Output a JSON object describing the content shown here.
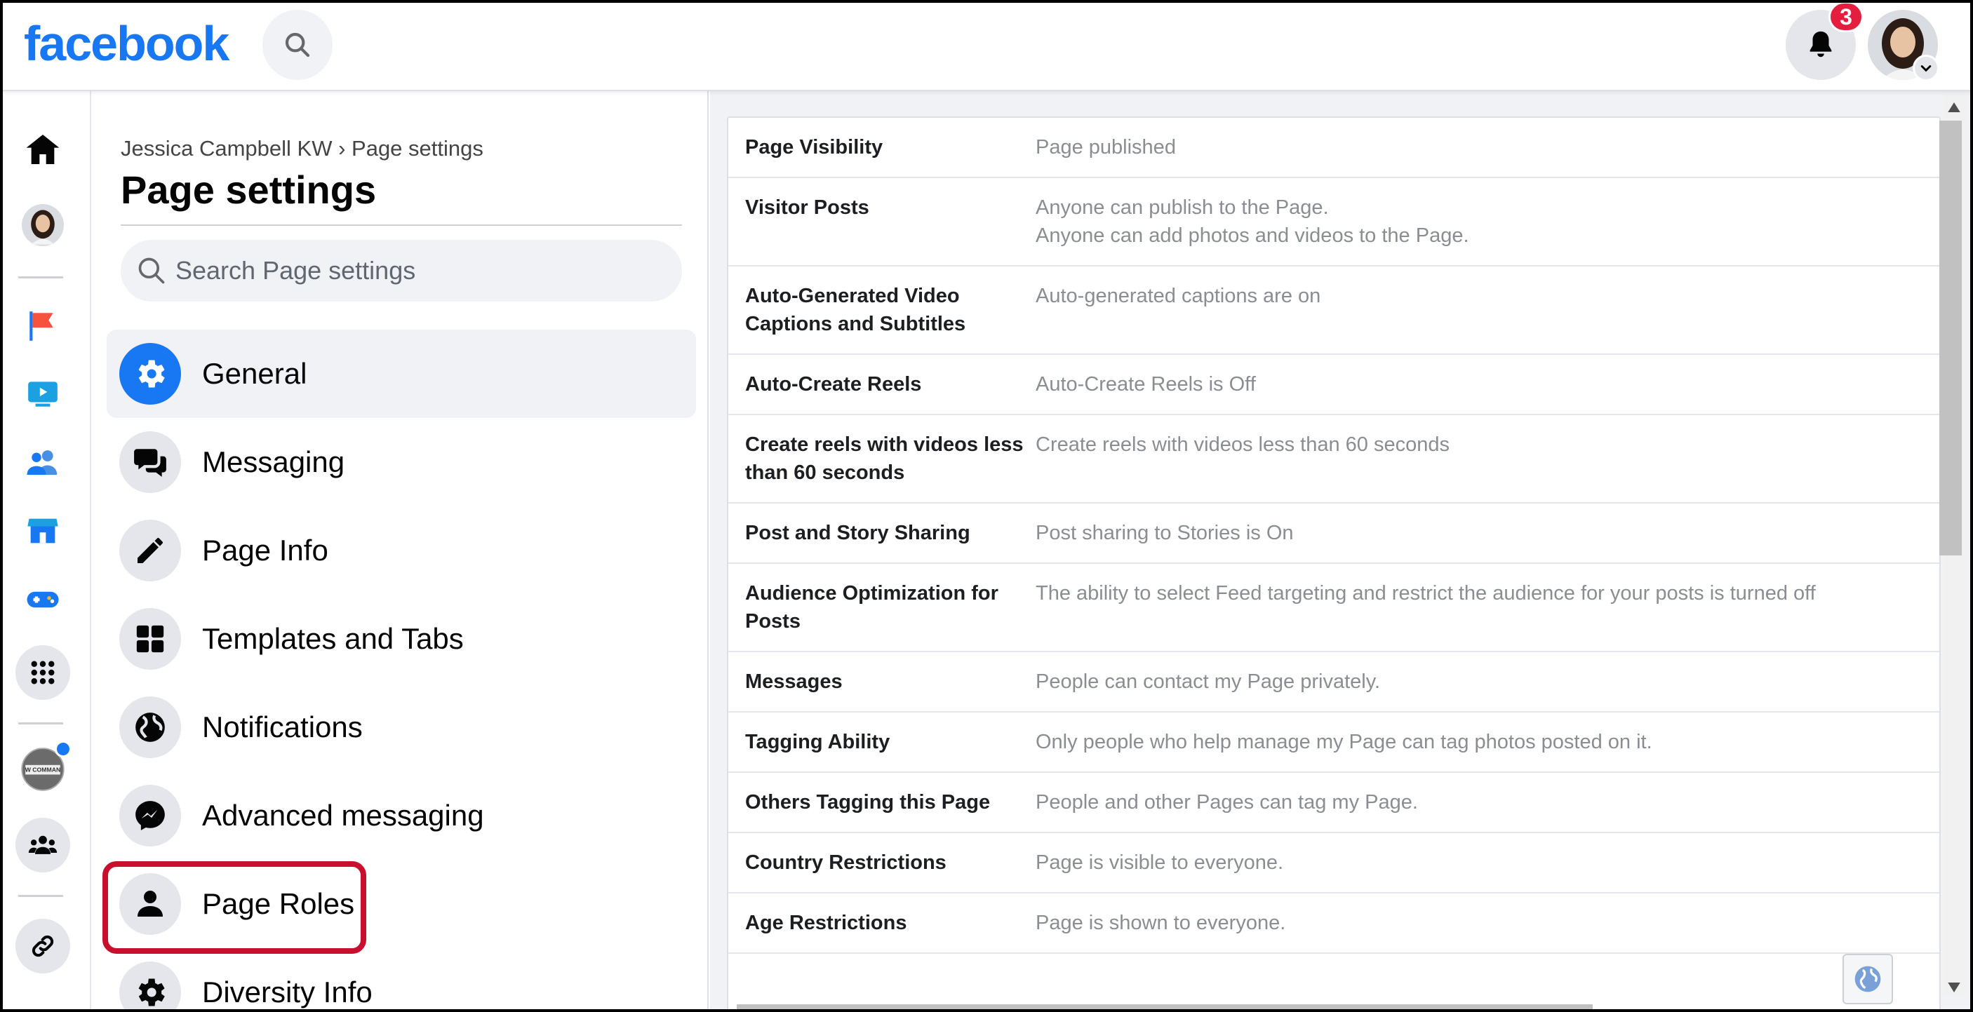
{
  "brand": {
    "logo_text": "facebook",
    "accent": "#1877f2"
  },
  "topbar": {
    "notification_count": "3",
    "icons": [
      "search-icon",
      "bell-icon",
      "chevron-down-icon"
    ]
  },
  "rail": {
    "items": [
      "home-icon",
      "profile-avatar",
      "pages-flag-icon",
      "watch-icon",
      "friends-icon",
      "marketplace-icon",
      "gaming-icon",
      "menu-grid-icon",
      "page-avatar",
      "groups-icon",
      "link-icon"
    ],
    "page_avatar_text": "W COMMAN"
  },
  "nav": {
    "breadcrumb": "Jessica Campbell KW › Page settings",
    "title": "Page settings",
    "search_placeholder": "Search Page settings",
    "items": [
      {
        "label": "General",
        "icon": "gear-icon",
        "active": true
      },
      {
        "label": "Messaging",
        "icon": "chat-icon",
        "active": false
      },
      {
        "label": "Page Info",
        "icon": "pencil-icon",
        "active": false
      },
      {
        "label": "Templates and Tabs",
        "icon": "grid-icon",
        "active": false
      },
      {
        "label": "Notifications",
        "icon": "globe-icon",
        "active": false
      },
      {
        "label": "Advanced messaging",
        "icon": "messenger-icon",
        "active": false
      },
      {
        "label": "Page Roles",
        "icon": "person-icon",
        "active": false
      },
      {
        "label": "Diversity Info",
        "icon": "gear-icon",
        "active": false
      }
    ],
    "highlighted_item": "Page Roles"
  },
  "settings": {
    "rows": [
      {
        "label": "Page Visibility",
        "value": [
          "Page published"
        ]
      },
      {
        "label": "Visitor Posts",
        "value": [
          "Anyone can publish to the Page.",
          "Anyone can add photos and videos to the Page."
        ]
      },
      {
        "label": "Auto-Generated Video Captions and Subtitles",
        "value": [
          "Auto-generated captions are on"
        ]
      },
      {
        "label": "Auto-Create Reels",
        "value": [
          "Auto-Create Reels is Off"
        ]
      },
      {
        "label": "Create reels with videos less than 60 seconds",
        "value": [
          "Create reels with videos less than 60 seconds"
        ]
      },
      {
        "label": "Post and Story Sharing",
        "value": [
          "Post sharing to Stories is On"
        ]
      },
      {
        "label": "Audience Optimization for Posts",
        "value": [
          "The ability to select Feed targeting and restrict the audience for your posts is turned off"
        ]
      },
      {
        "label": "Messages",
        "value": [
          "People can contact my Page privately."
        ]
      },
      {
        "label": "Tagging Ability",
        "value": [
          "Only people who help manage my Page can tag photos posted on it."
        ]
      },
      {
        "label": "Others Tagging this Page",
        "value": [
          "People and other Pages can tag my Page."
        ]
      },
      {
        "label": "Country Restrictions",
        "value": [
          "Page is visible to everyone."
        ]
      },
      {
        "label": "Age Restrictions",
        "value": [
          "Page is shown to everyone."
        ]
      }
    ]
  }
}
